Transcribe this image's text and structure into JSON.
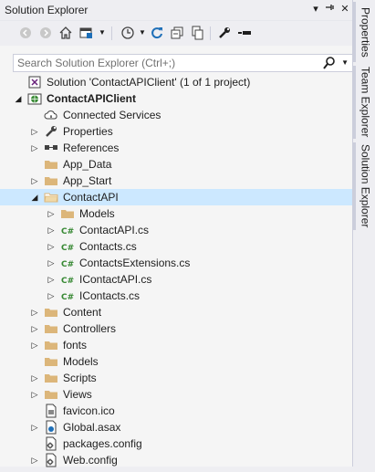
{
  "window": {
    "title": "Solution Explorer",
    "pin_glyph": "▾",
    "autohide_glyph": "⊣",
    "close_glyph": "✕"
  },
  "search": {
    "placeholder": "Search Solution Explorer (Ctrl+;)",
    "value": ""
  },
  "side_tabs": [
    "Properties",
    "Team Explorer",
    "Solution Explorer"
  ],
  "tree": [
    {
      "label": "Solution 'ContactAPIClient' (1 of 1 project)",
      "icon": "solution-icon",
      "expander": "none",
      "level": 0
    },
    {
      "label": "ContactAPIClient",
      "icon": "web-project-icon",
      "expander": "expanded",
      "level": 0,
      "bold": true
    },
    {
      "label": "Connected Services",
      "icon": "cloud-icon",
      "expander": "none",
      "level": 1
    },
    {
      "label": "Properties",
      "icon": "wrench-icon",
      "expander": "collapsed",
      "level": 1
    },
    {
      "label": "References",
      "icon": "references-icon",
      "expander": "collapsed",
      "level": 1
    },
    {
      "label": "App_Data",
      "icon": "folder-icon",
      "expander": "none",
      "level": 1
    },
    {
      "label": "App_Start",
      "icon": "folder-icon",
      "expander": "collapsed",
      "level": 1
    },
    {
      "label": "ContactAPI",
      "icon": "folder-open-icon",
      "expander": "expanded",
      "level": 1,
      "selected": true
    },
    {
      "label": "Models",
      "icon": "folder-icon",
      "expander": "collapsed",
      "level": 2
    },
    {
      "label": "ContactAPI.cs",
      "icon": "csharp-file-icon",
      "expander": "collapsed",
      "level": 2
    },
    {
      "label": "Contacts.cs",
      "icon": "csharp-file-icon",
      "expander": "collapsed",
      "level": 2
    },
    {
      "label": "ContactsExtensions.cs",
      "icon": "csharp-file-icon",
      "expander": "collapsed",
      "level": 2
    },
    {
      "label": "IContactAPI.cs",
      "icon": "csharp-file-icon",
      "expander": "collapsed",
      "level": 2
    },
    {
      "label": "IContacts.cs",
      "icon": "csharp-file-icon",
      "expander": "collapsed",
      "level": 2
    },
    {
      "label": "Content",
      "icon": "folder-icon",
      "expander": "collapsed",
      "level": 1
    },
    {
      "label": "Controllers",
      "icon": "folder-icon",
      "expander": "collapsed",
      "level": 1
    },
    {
      "label": "fonts",
      "icon": "folder-icon",
      "expander": "collapsed",
      "level": 1
    },
    {
      "label": "Models",
      "icon": "folder-icon",
      "expander": "none",
      "level": 1
    },
    {
      "label": "Scripts",
      "icon": "folder-icon",
      "expander": "collapsed",
      "level": 1
    },
    {
      "label": "Views",
      "icon": "folder-icon",
      "expander": "collapsed",
      "level": 1
    },
    {
      "label": "favicon.ico",
      "icon": "image-file-icon",
      "expander": "none",
      "level": 1
    },
    {
      "label": "Global.asax",
      "icon": "global-asax-icon",
      "expander": "collapsed",
      "level": 1
    },
    {
      "label": "packages.config",
      "icon": "config-file-icon",
      "expander": "none",
      "level": 1
    },
    {
      "label": "Web.config",
      "icon": "config-file-icon",
      "expander": "collapsed",
      "level": 1
    }
  ],
  "colors": {
    "selection": "#cce8ff",
    "folder": "#dcb67a",
    "csharp": "#368832",
    "accent_blue": "#1e6fb8"
  }
}
